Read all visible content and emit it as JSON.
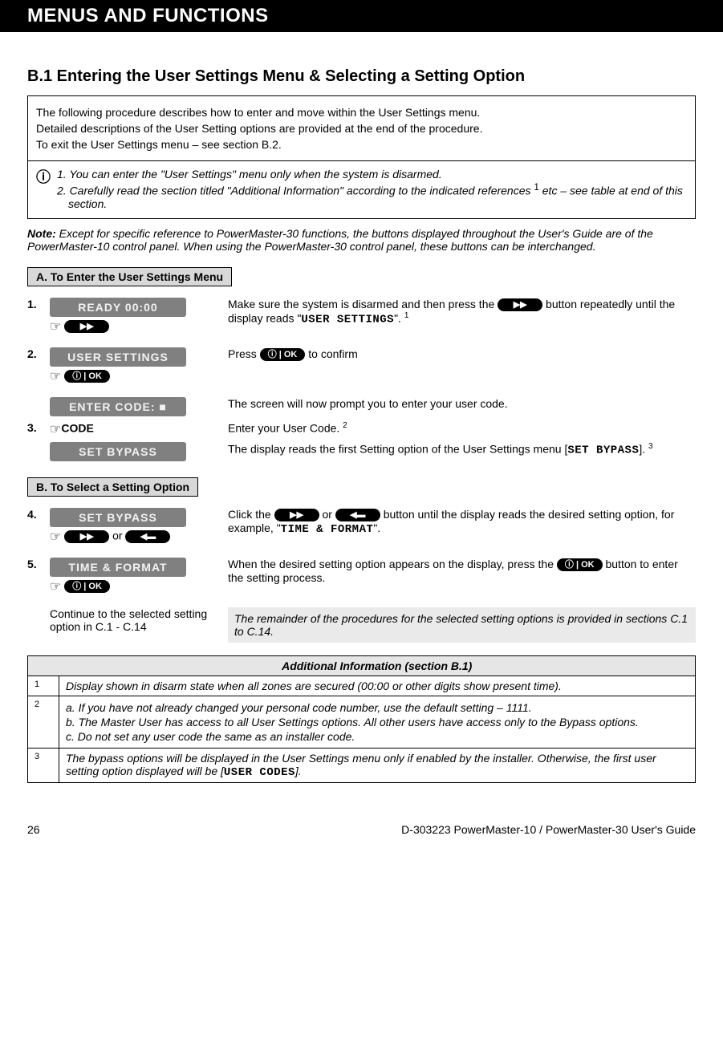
{
  "header": "MENUS AND FUNCTIONS",
  "section_title": "B.1 Entering the User Settings Menu & Selecting a Setting Option",
  "intro": {
    "p1": "The following procedure describes how to enter and move within the User Settings menu.",
    "p2": "Detailed descriptions of the User Setting options are provided at the end of the procedure.",
    "p3": "To exit the User Settings menu – see section B.2.",
    "info_icon": "ⓘ",
    "note1": "1. You can enter the \"User Settings\" menu only when the system is disarmed.",
    "note2_a": "2. Carefully read the section titled \"Additional Information\" according to the indicated references ",
    "note2_sup": "1",
    "note2_b": " etc – see table at end of this section."
  },
  "note_para_prefix": "Note:",
  "note_para_body": " Except for specific reference to PowerMaster-30 functions, the buttons displayed throughout the User's Guide are of the PowerMaster-10 control panel. When using the PowerMaster-30 control panel, these buttons can be interchanged.",
  "subA": "A. To Enter the User Settings Menu",
  "subB": "B. To Select a Setting Option",
  "btn_forward": "▶▶",
  "btn_back": "◀▬",
  "btn_ok": "ⓘ | OK",
  "hand": "☞",
  "steps": {
    "s1": {
      "num": "1.",
      "lcd": "READY 00:00",
      "desc_a": "Make sure the system is disarmed and then press the ",
      "desc_b": " button repeatedly until the display reads \"",
      "desc_lcd": "USER SETTINGS",
      "desc_c": "\". ",
      "sup": "1"
    },
    "s2": {
      "num": "2.",
      "lcd": "USER SETTINGS",
      "desc_a": "Press ",
      "desc_b": " to confirm"
    },
    "sEnter": {
      "lcd": "ENTER CODE: ■",
      "desc": "The screen will now prompt you to enter your user code."
    },
    "s3": {
      "num": "3.",
      "code_label": "CODE",
      "desc_a": "Enter your User Code. ",
      "sup": "2"
    },
    "sBypass": {
      "lcd": "SET BYPASS",
      "desc_a": "The display reads the first Setting option of the User Settings menu [",
      "desc_lcd": "SET BYPASS",
      "desc_b": "]. ",
      "sup": "3"
    },
    "s4": {
      "num": "4.",
      "lcd": "SET BYPASS",
      "or": " or ",
      "desc_a": "Click the ",
      "desc_mid": " or ",
      "desc_b": " button until the display reads the desired setting option, for example, \"",
      "desc_lcd": "TIME & FORMAT",
      "desc_c": "\"."
    },
    "s5": {
      "num": "5.",
      "lcd": "TIME & FORMAT",
      "desc_a": "When the desired setting option appears on the display, press the ",
      "desc_b": " button to enter the setting process."
    },
    "cont": {
      "left": "Continue to the selected setting option in C.1 - C.14",
      "right": "The remainder of the procedures for the selected setting options is provided in sections C.1 to C.14."
    }
  },
  "addl": {
    "title": "Additional Information (section B.1)",
    "r1": {
      "ref": "1",
      "text": "Display shown in disarm state when all zones are secured (00:00 or other digits show present time)."
    },
    "r2": {
      "ref": "2",
      "a": "a.   If you have not already changed your personal code number, use the default setting – 1111.",
      "b": "b.   The Master User has access to all User Settings options. All other users have access only to the Bypass options.",
      "c": "c.   Do not set any user code the same as an installer code."
    },
    "r3": {
      "ref": "3",
      "text_a": "The bypass options will be displayed in the User Settings menu only if enabled by the installer. Otherwise, the first user setting option displayed will be [",
      "text_lcd": "USER CODES",
      "text_b": "]."
    }
  },
  "footer": {
    "page": "26",
    "doc": "D-303223 PowerMaster-10 / PowerMaster-30 User's Guide"
  }
}
